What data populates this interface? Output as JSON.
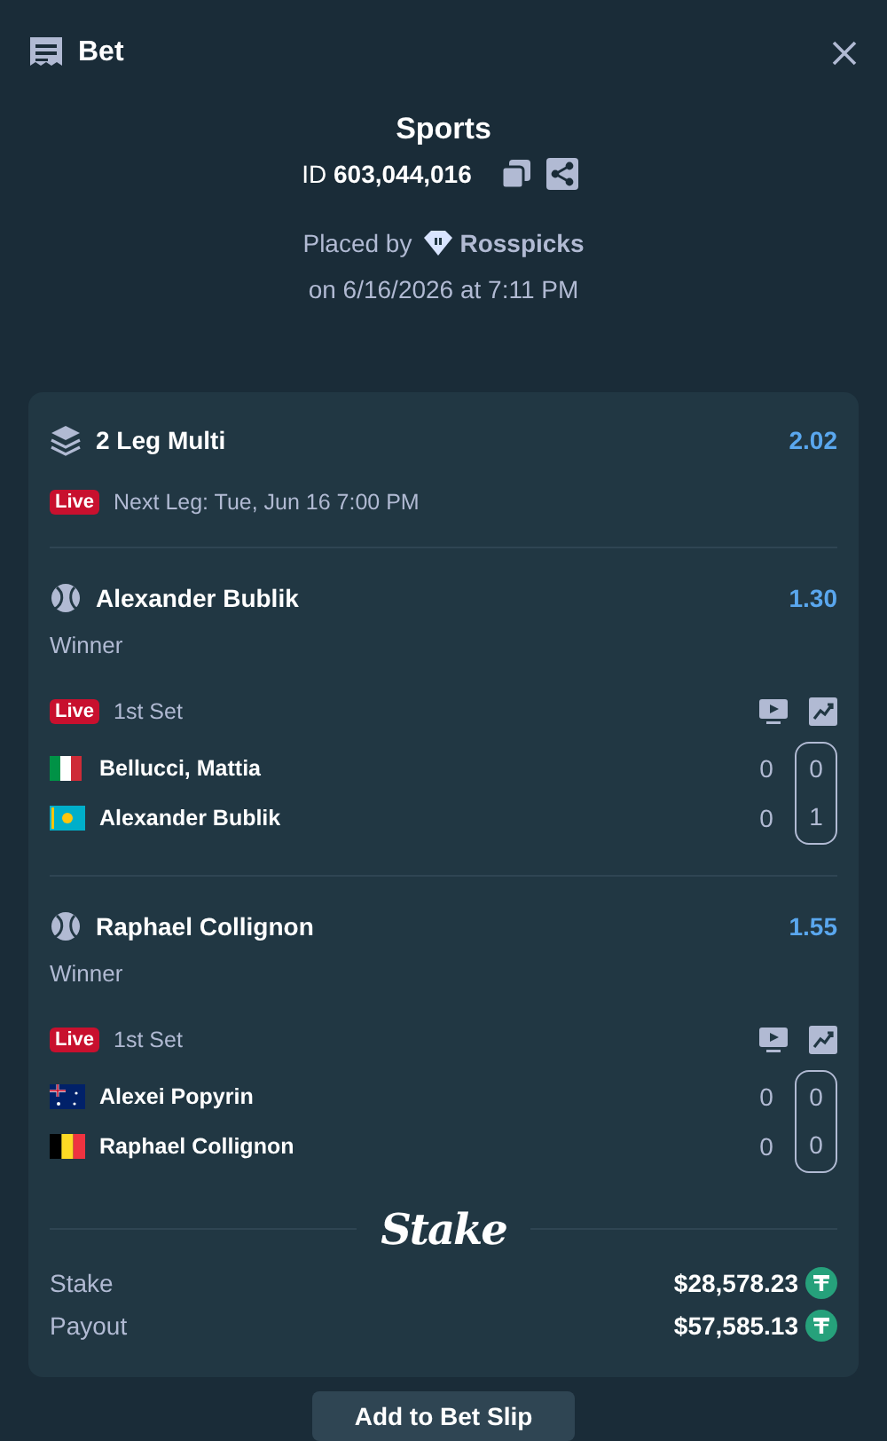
{
  "header": {
    "title": "Bet"
  },
  "summary": {
    "category": "Sports",
    "id_label": "ID",
    "id_value": "603,044,016",
    "placed_by_label": "Placed by",
    "placed_by_user": "Rosspicks",
    "placed_on": "on 6/16/2026 at 7:11 PM"
  },
  "multi": {
    "title": "2 Leg Multi",
    "odds": "2.02",
    "status": "Live",
    "next_leg": "Next Leg: Tue, Jun 16 7:00 PM"
  },
  "legs": [
    {
      "selection": "Alexander Bublik",
      "odds": "1.30",
      "market": "Winner",
      "status": "Live",
      "period": "1st Set",
      "players": [
        {
          "name": "Bellucci, Mattia",
          "kind": "italy",
          "scores": [
            "0",
            "0"
          ]
        },
        {
          "name": "Alexander Bublik",
          "kind": "kazakhstan",
          "scores": [
            "0",
            "1"
          ]
        }
      ]
    },
    {
      "selection": "Raphael Collignon",
      "odds": "1.55",
      "market": "Winner",
      "status": "Live",
      "period": "1st Set",
      "players": [
        {
          "name": "Alexei Popyrin",
          "kind": "australia",
          "scores": [
            "0",
            "0"
          ]
        },
        {
          "name": "Raphael Collignon",
          "kind": "belgium",
          "scores": [
            "0",
            "0"
          ]
        }
      ]
    }
  ],
  "brand": "Stake",
  "totals": [
    {
      "label": "Stake",
      "amount": "$28,578.23"
    },
    {
      "label": "Payout",
      "amount": "$57,585.13"
    }
  ],
  "buttons": [
    {
      "label": "Add to Bet Slip"
    }
  ]
}
